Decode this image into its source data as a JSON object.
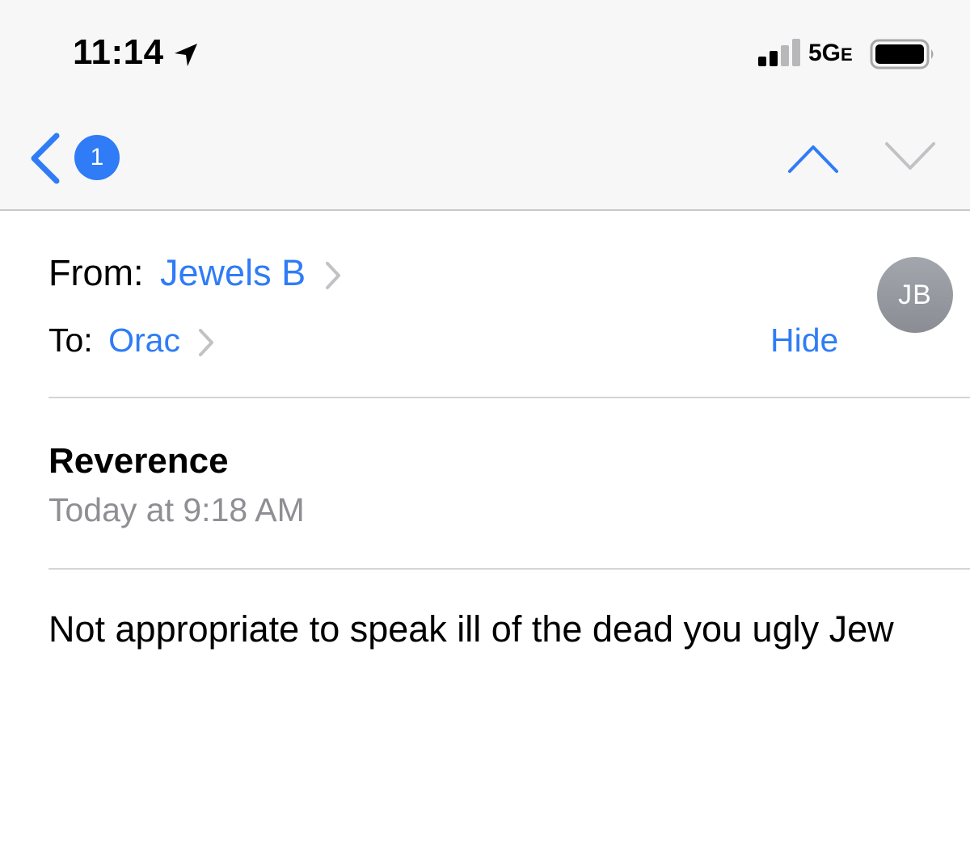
{
  "status_bar": {
    "time": "11:14",
    "network": "5G",
    "network_suffix": "E",
    "icons": [
      "location-arrow-icon",
      "signal-icon",
      "battery-icon"
    ]
  },
  "nav": {
    "unread_count": "1",
    "icons": [
      "back-chevron-icon",
      "chevron-up-icon",
      "chevron-down-icon"
    ]
  },
  "header": {
    "from_label": "From:",
    "from_name": "Jewels B",
    "to_label": "To:",
    "to_name": "Orac",
    "hide_label": "Hide",
    "avatar_initials": "JB"
  },
  "message": {
    "subject": "Reverence",
    "date": "Today at 9:18 AM",
    "body": "Not appropriate to speak ill of the dead you ugly Jew"
  },
  "colors": {
    "accent": "#2f7cf6",
    "secondary_text": "#8e8e93",
    "bar_background": "#f7f7f7"
  }
}
